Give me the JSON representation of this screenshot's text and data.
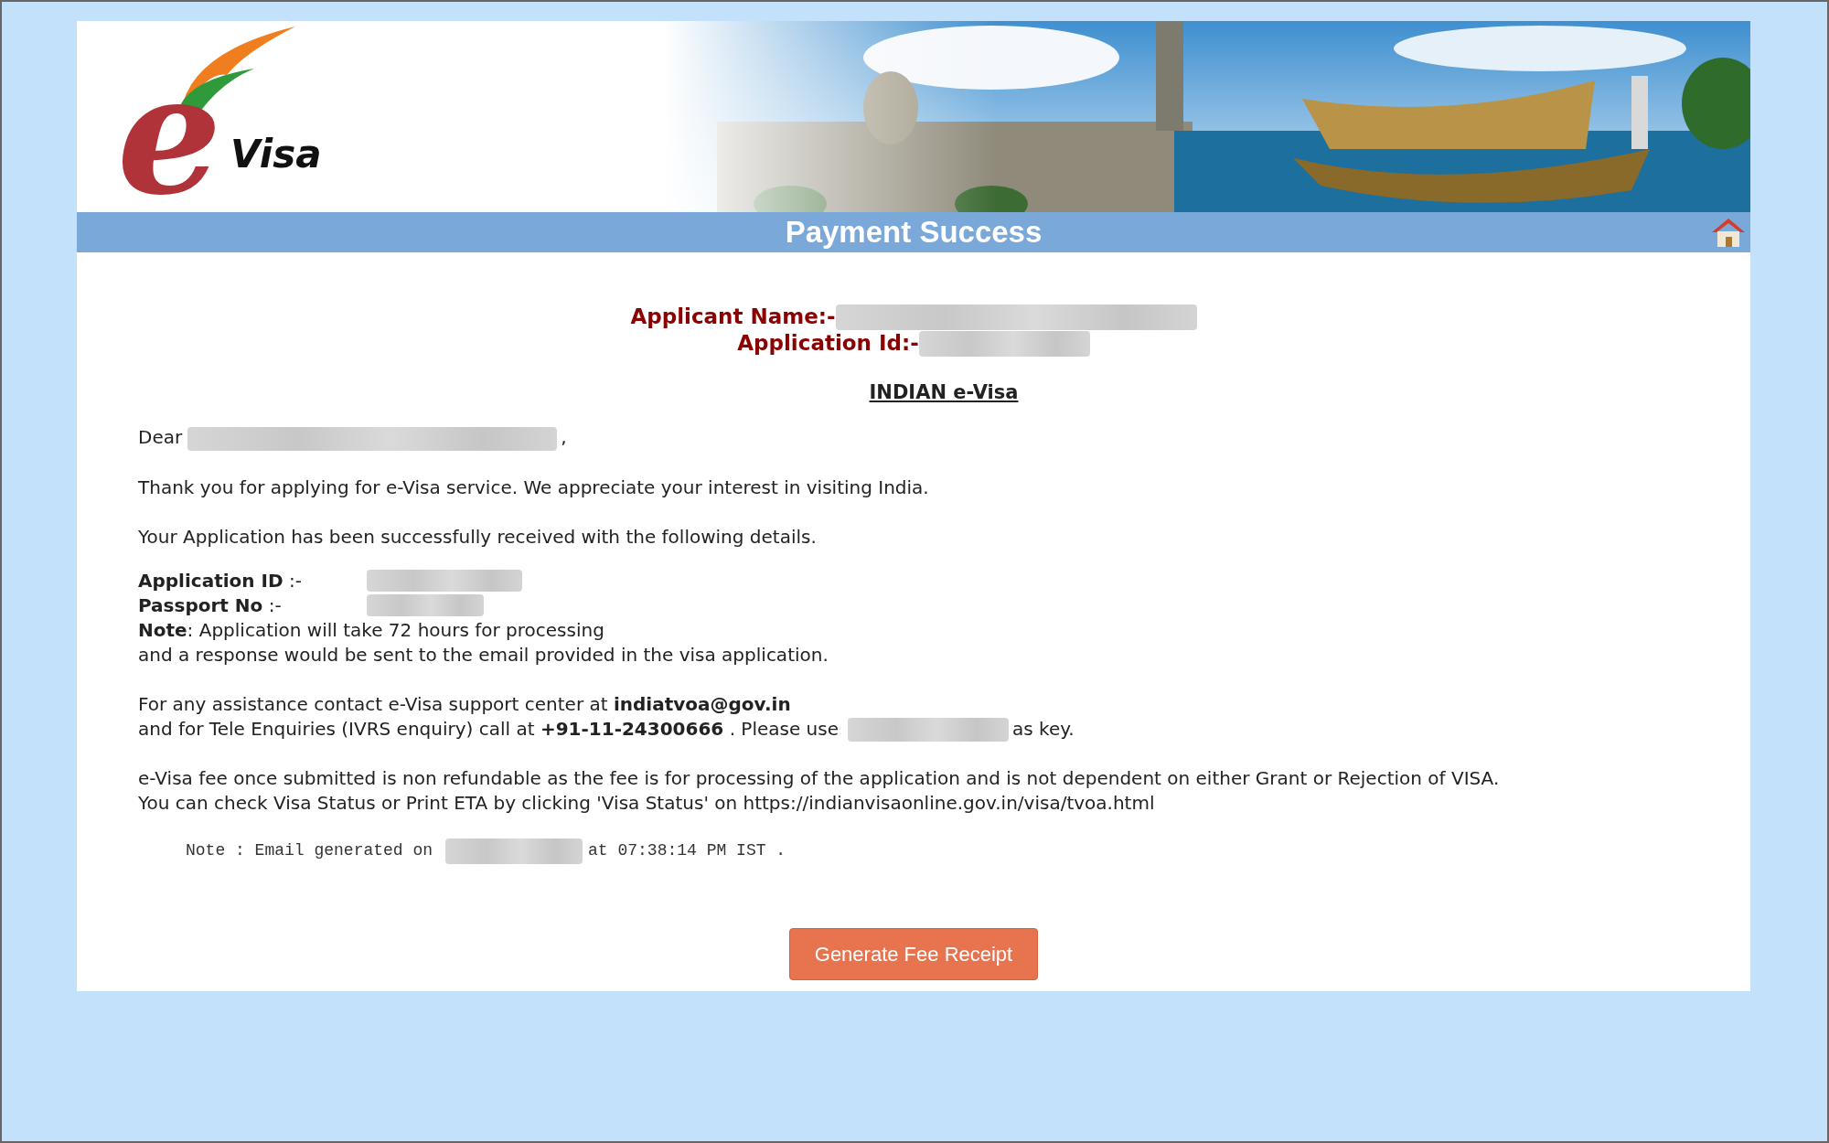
{
  "logo": {
    "letter": "e",
    "word": "Visa"
  },
  "title": "Payment Success",
  "applicant": [
    {
      "label": "Applicant Name:-"
    },
    {
      "label": "Application Id:-"
    }
  ],
  "heading": "INDIAN e-Visa",
  "greeting": {
    "text": "Dear",
    "suffix": ","
  },
  "intro": [
    "Thank you for applying for e-Visa service. We appreciate your interest in visiting India.",
    "Your Application has been successfully received with the following details."
  ],
  "details": [
    {
      "label": "**Application ID** :-"
    },
    {
      "label": "**Passport No** :-"
    }
  ],
  "note": [
    "**Note**: Application will take 72 hours for processing",
    "and a response would be sent to the email provided in the visa application."
  ],
  "contact": {
    "line_1": "For any assistance contact e-Visa support center at **indiatvoa@gov.in**",
    "line_2": "and for Tele Enquiries (IVRS enquiry) call at **+91-11-24300666** . Please use",
    "line_2_end": "as key."
  },
  "fee": [
    "e-Visa fee once submitted is non refundable as the fee is for processing of the application and is not dependent on either Grant or Rejection of VISA.",
    "You can check Visa Status or Print ETA by clicking 'Visa Status' on https://indianvisaonline.gov.in/visa/tvoa.html"
  ],
  "email_note": {
    "before": "Note : Email generated on",
    "after": "at 07:38:14 PM IST ."
  },
  "button": "Generate Fee Receipt"
}
